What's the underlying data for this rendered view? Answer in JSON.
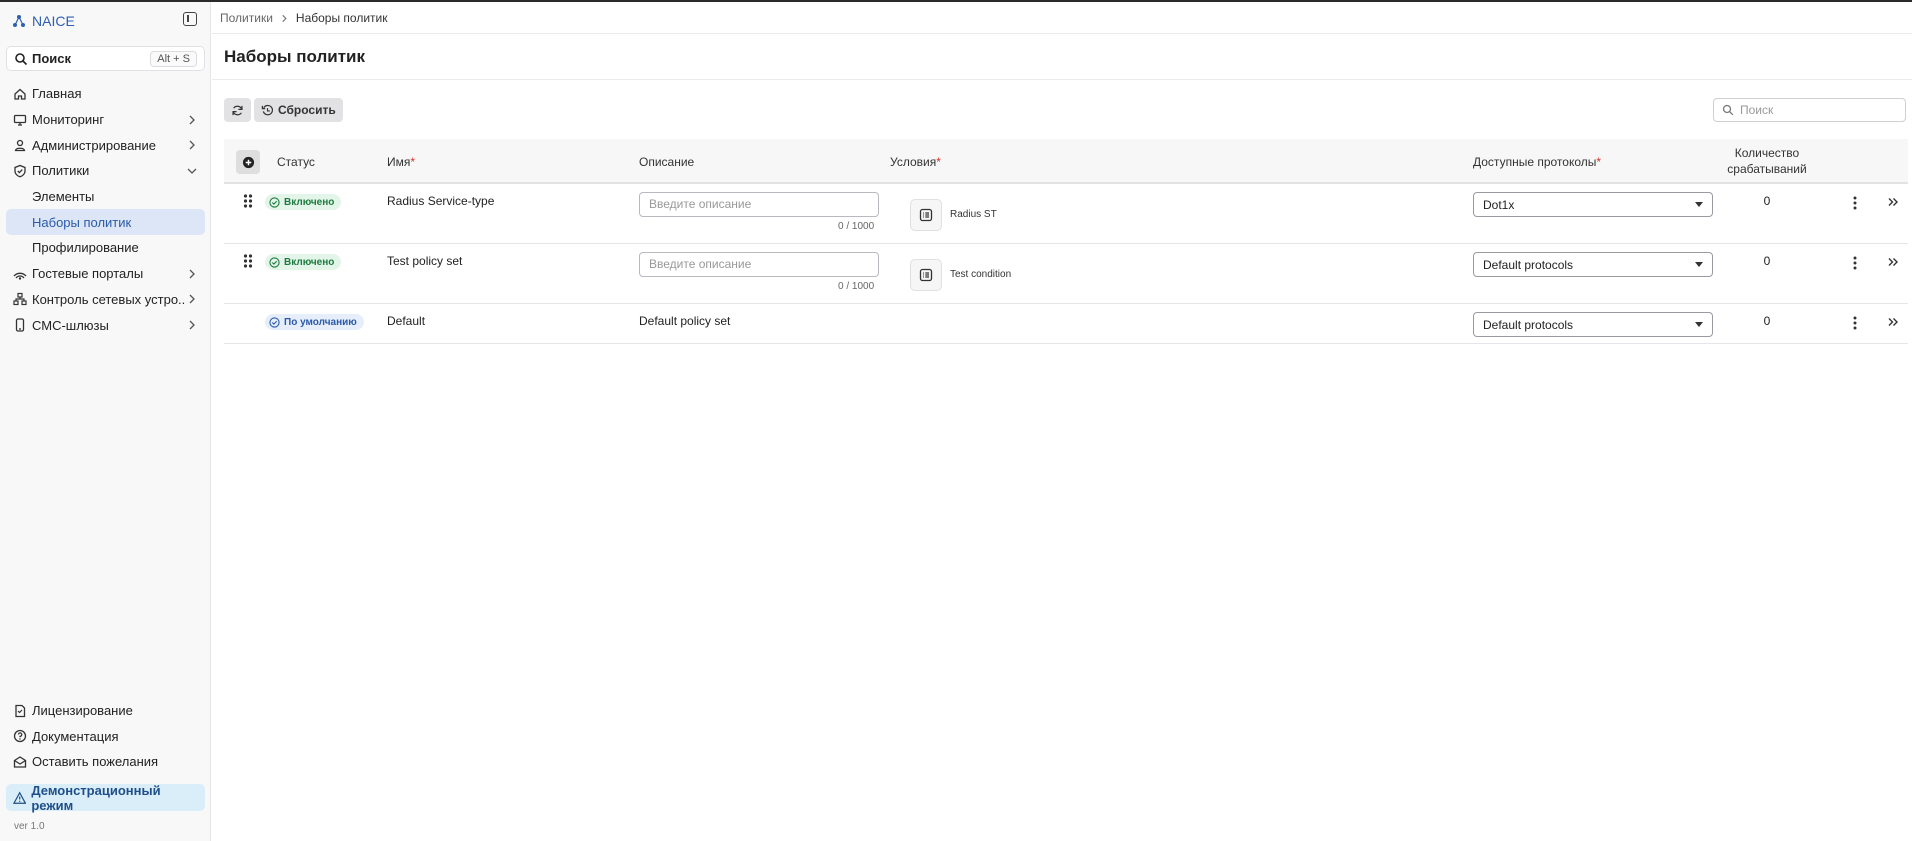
{
  "app": {
    "name": "NAICE"
  },
  "search": {
    "label": "Поиск",
    "shortcut": "Alt + S"
  },
  "sidebar": {
    "items": [
      {
        "label": "Главная"
      },
      {
        "label": "Мониторинг"
      },
      {
        "label": "Администрирование"
      },
      {
        "label": "Политики"
      },
      {
        "label": "Элементы"
      },
      {
        "label": "Наборы политик"
      },
      {
        "label": "Профилирование"
      },
      {
        "label": "Гостевые порталы"
      },
      {
        "label": "Контроль сетевых устро..."
      },
      {
        "label": "СМС-шлюзы"
      }
    ],
    "bottom": [
      {
        "label": "Лицензирование"
      },
      {
        "label": "Документация"
      },
      {
        "label": "Оставить пожелания"
      }
    ],
    "demo_mode": "Демонстрационный режим",
    "version": "ver 1.0"
  },
  "breadcrumb": {
    "parent": "Политики",
    "current": "Наборы политик"
  },
  "page": {
    "title": "Наборы политик"
  },
  "toolbar": {
    "reset_label": "Сбросить",
    "search_placeholder": "Поиск"
  },
  "table": {
    "headers": {
      "status": "Статус",
      "name": "Имя",
      "description": "Описание",
      "conditions": "Условия",
      "protocols": "Доступные протоколы",
      "hits_line1": "Количество",
      "hits_line2": "срабатываний",
      "required_mark": "*"
    },
    "desc_placeholder": "Введите описание",
    "rows": [
      {
        "status": "Включено",
        "name": "Radius Service-type",
        "desc_count": "0 / 1000",
        "condition": "Radius ST",
        "protocol": "Dot1x",
        "hits": "0"
      },
      {
        "status": "Включено",
        "name": "Test policy set",
        "desc_count": "0 / 1000",
        "condition": "Test condition",
        "protocol": "Default protocols",
        "hits": "0"
      },
      {
        "status": "По умолчанию",
        "name": "Default",
        "description": "Default policy set",
        "protocol": "Default protocols",
        "hits": "0"
      }
    ]
  },
  "colors": {
    "accent": "#2f5fb3",
    "active_bg": "#dce6f7",
    "enabled_bg": "#e3f5e9",
    "enabled_fg": "#1e7a3f",
    "required": "#d93025"
  }
}
